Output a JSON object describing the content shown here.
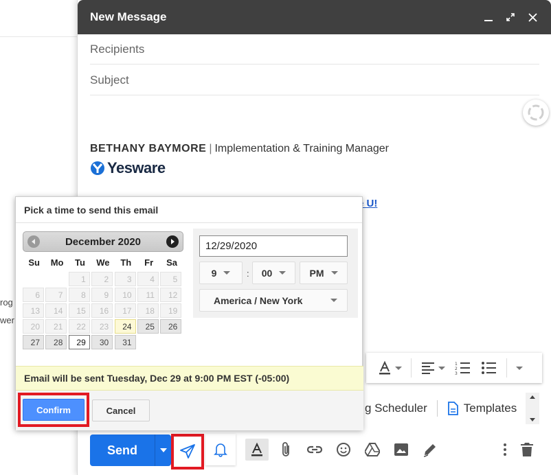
{
  "background": {
    "fragment_1": "rog",
    "fragment_2": "wer"
  },
  "compose": {
    "title": "New Message",
    "recipients_placeholder": "Recipients",
    "subject_placeholder": "Subject",
    "signature": {
      "name": "BETHANY BAYMORE",
      "separator": "|",
      "role": "Implementation & Training Manager",
      "logo_text": "Yesware"
    },
    "link_fragment": "e U!",
    "extensions": {
      "scheduler_label": "g Scheduler",
      "templates_label": "Templates"
    },
    "send_label": "Send"
  },
  "scheduler": {
    "title": "Pick a time to send this email",
    "calendar": {
      "month_label": "December 2020",
      "weekdays": [
        "Su",
        "Mo",
        "Tu",
        "We",
        "Th",
        "Fr",
        "Sa"
      ],
      "days": [
        "1",
        "2",
        "3",
        "4",
        "5",
        "6",
        "7",
        "8",
        "9",
        "10",
        "11",
        "12",
        "13",
        "14",
        "15",
        "16",
        "17",
        "18",
        "19",
        "20",
        "21",
        "22",
        "23",
        "24",
        "25",
        "26",
        "27",
        "28",
        "29",
        "30",
        "31"
      ],
      "selected_day": "29",
      "today_day": "24"
    },
    "date_value": "12/29/2020",
    "hour": "9",
    "colon": ":",
    "minute": "00",
    "ampm": "PM",
    "timezone": "America / New York",
    "notice": "Email will be sent Tuesday, Dec 29 at 9:00 PM EST (-05:00)",
    "confirm_label": "Confirm",
    "cancel_label": "Cancel"
  },
  "colors": {
    "header_bg": "#404040",
    "send_blue": "#1a73e8",
    "confirm_blue": "#4d90fe",
    "highlight_red": "#e21a23",
    "notice_bg": "#fafbd2"
  }
}
